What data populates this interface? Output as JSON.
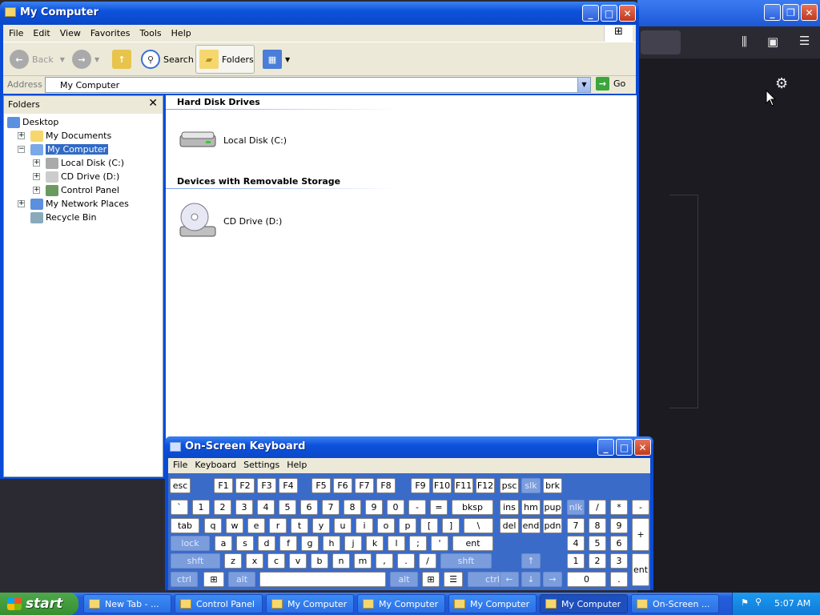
{
  "explorer": {
    "title": "My Computer",
    "menu": [
      "File",
      "Edit",
      "View",
      "Favorites",
      "Tools",
      "Help"
    ],
    "toolbar": {
      "back": "Back",
      "search": "Search",
      "folders": "Folders"
    },
    "address": {
      "label": "Address",
      "value": "My Computer",
      "go": "Go"
    },
    "folders_pane": {
      "title": "Folders",
      "tree": [
        {
          "label": "Desktop",
          "depth": 0,
          "expander": "",
          "selected": false
        },
        {
          "label": "My Documents",
          "depth": 1,
          "expander": "+",
          "selected": false
        },
        {
          "label": "My Computer",
          "depth": 1,
          "expander": "−",
          "selected": true
        },
        {
          "label": "Local Disk (C:)",
          "depth": 2,
          "expander": "+",
          "selected": false
        },
        {
          "label": "CD Drive (D:)",
          "depth": 2,
          "expander": "+",
          "selected": false
        },
        {
          "label": "Control Panel",
          "depth": 2,
          "expander": "+",
          "selected": false
        },
        {
          "label": "My Network Places",
          "depth": 1,
          "expander": "+",
          "selected": false
        },
        {
          "label": "Recycle Bin",
          "depth": 1,
          "expander": "",
          "selected": false
        }
      ]
    },
    "groups": [
      {
        "heading": "Hard Disk Drives",
        "items": [
          "Local Disk (C:)"
        ]
      },
      {
        "heading": "Devices with Removable Storage",
        "items": [
          "CD Drive (D:)"
        ]
      }
    ]
  },
  "osk": {
    "title": "On-Screen Keyboard",
    "menu": [
      "File",
      "Keyboard",
      "Settings",
      "Help"
    ],
    "rows": [
      [
        [
          "esc",
          ""
        ],
        [
          "F1",
          ""
        ],
        [
          "F2",
          ""
        ],
        [
          "F3",
          ""
        ],
        [
          "F4",
          ""
        ],
        [
          "F5",
          ""
        ],
        [
          "F6",
          ""
        ],
        [
          "F7",
          ""
        ],
        [
          "F8",
          ""
        ],
        [
          "F9",
          ""
        ],
        [
          "F10",
          ""
        ],
        [
          "F11",
          ""
        ],
        [
          "F12",
          ""
        ],
        [
          "psc",
          ""
        ],
        [
          "slk",
          "dim"
        ],
        [
          "brk",
          ""
        ]
      ],
      [
        [
          "`",
          ""
        ],
        [
          "1",
          ""
        ],
        [
          "2",
          ""
        ],
        [
          "3",
          ""
        ],
        [
          "4",
          ""
        ],
        [
          "5",
          ""
        ],
        [
          "6",
          ""
        ],
        [
          "7",
          ""
        ],
        [
          "8",
          ""
        ],
        [
          "9",
          ""
        ],
        [
          "0",
          ""
        ],
        [
          "-",
          ""
        ],
        [
          "=",
          ""
        ],
        [
          "bksp",
          ""
        ],
        [
          "ins",
          ""
        ],
        [
          "hm",
          ""
        ],
        [
          "pup",
          ""
        ],
        [
          "nlk",
          "dim"
        ],
        [
          "/",
          ""
        ],
        [
          "*",
          ""
        ],
        [
          "-",
          ""
        ]
      ],
      [
        [
          "tab",
          ""
        ],
        [
          "q",
          ""
        ],
        [
          "w",
          ""
        ],
        [
          "e",
          ""
        ],
        [
          "r",
          ""
        ],
        [
          "t",
          ""
        ],
        [
          "y",
          ""
        ],
        [
          "u",
          ""
        ],
        [
          "i",
          ""
        ],
        [
          "o",
          ""
        ],
        [
          "p",
          ""
        ],
        [
          "[",
          ""
        ],
        [
          "]",
          ""
        ],
        [
          "\\",
          ""
        ],
        [
          "del",
          ""
        ],
        [
          "end",
          ""
        ],
        [
          "pdn",
          ""
        ],
        [
          "7",
          ""
        ],
        [
          "8",
          ""
        ],
        [
          "9",
          ""
        ],
        [
          "+",
          ""
        ]
      ],
      [
        [
          "lock",
          "dim"
        ],
        [
          "a",
          ""
        ],
        [
          "s",
          ""
        ],
        [
          "d",
          ""
        ],
        [
          "f",
          ""
        ],
        [
          "g",
          ""
        ],
        [
          "h",
          ""
        ],
        [
          "j",
          ""
        ],
        [
          "k",
          ""
        ],
        [
          "l",
          ""
        ],
        [
          ";",
          ""
        ],
        [
          "'",
          ""
        ],
        [
          "ent",
          ""
        ],
        [
          "4",
          ""
        ],
        [
          "5",
          ""
        ],
        [
          "6",
          ""
        ]
      ],
      [
        [
          "shft",
          "dim"
        ],
        [
          "z",
          ""
        ],
        [
          "x",
          ""
        ],
        [
          "c",
          ""
        ],
        [
          "v",
          ""
        ],
        [
          "b",
          ""
        ],
        [
          "n",
          ""
        ],
        [
          "m",
          ""
        ],
        [
          ",",
          ""
        ],
        [
          ".",
          ""
        ],
        [
          "/",
          ""
        ],
        [
          "shft",
          "dim"
        ],
        [
          "↑",
          "dim"
        ],
        [
          "1",
          ""
        ],
        [
          "2",
          ""
        ],
        [
          "3",
          ""
        ],
        [
          "ent",
          ""
        ]
      ],
      [
        [
          "ctrl",
          "dim"
        ],
        [
          "⊞",
          ""
        ],
        [
          "alt",
          "dim"
        ],
        [
          " ",
          ""
        ],
        [
          "alt",
          "dim"
        ],
        [
          "⊞",
          ""
        ],
        [
          "☰",
          ""
        ],
        [
          "ctrl",
          "dim"
        ],
        [
          "←",
          "dim"
        ],
        [
          "↓",
          "dim"
        ],
        [
          "→",
          "dim"
        ],
        [
          "0",
          ""
        ],
        [
          ".",
          ""
        ]
      ]
    ]
  },
  "taskbar": {
    "start": "start",
    "tasks": [
      "New Tab - ...",
      "Control Panel",
      "My Computer",
      "My Computer",
      "My Computer",
      "My Computer",
      "On-Screen ..."
    ],
    "clock": "5:07 AM"
  },
  "colors": {
    "xp_blue": "#0a4bd6",
    "start_green": "#36902f",
    "selection": "#316ac5"
  },
  "icons": [
    "gear-icon",
    "library-icon",
    "sidebar-icon",
    "hamburger-menu-icon",
    "back-arrow-icon",
    "forward-arrow-icon",
    "up-folder-icon",
    "search-icon",
    "folders-icon",
    "views-icon"
  ]
}
